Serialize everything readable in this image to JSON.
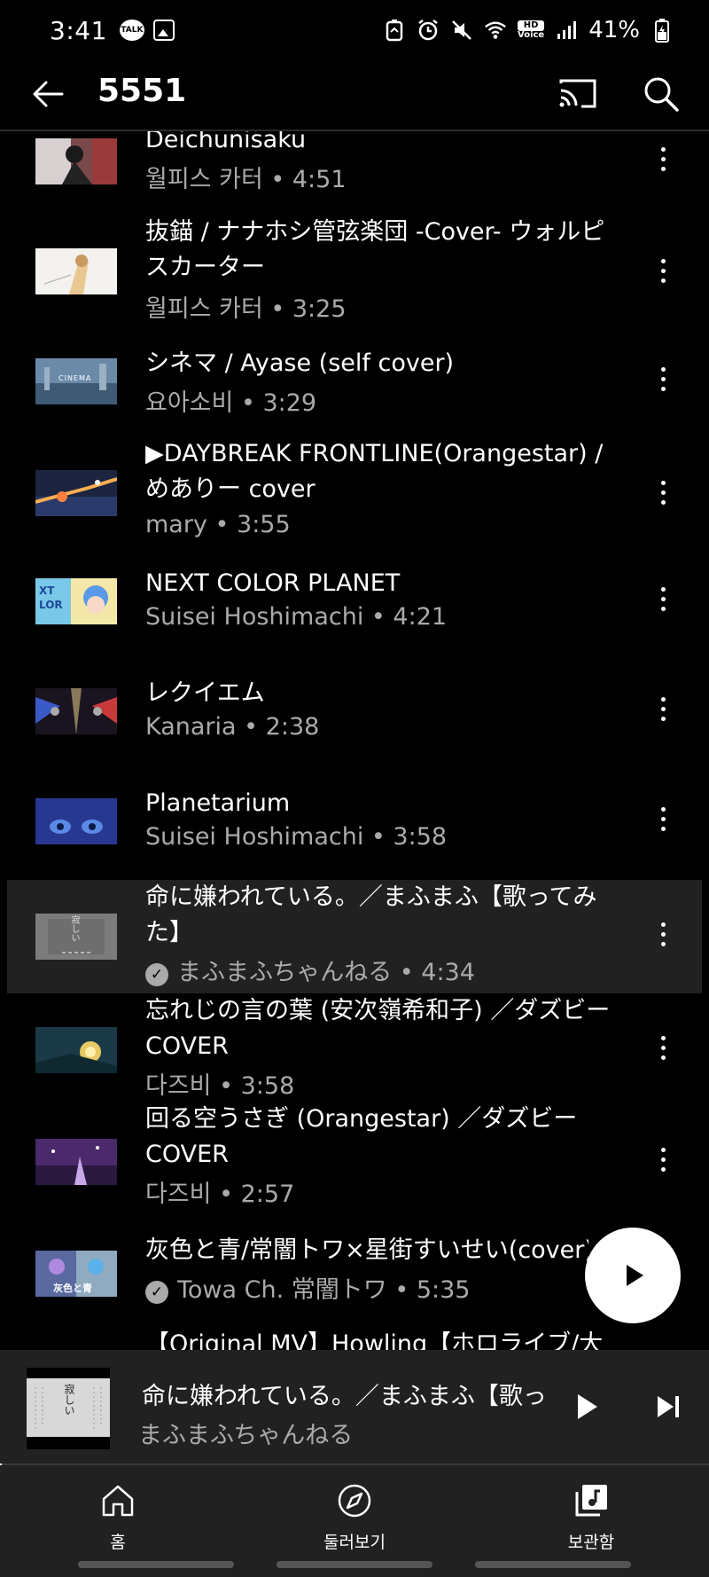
{
  "status_bar": {
    "time": "3:41",
    "talk_badge": "TALK",
    "hd_label_top": "HD",
    "hd_label_bottom": "Voice",
    "battery": "41%"
  },
  "app_bar": {
    "title": "5551"
  },
  "items": [
    {
      "title": "Deichunisaku",
      "subtitle": "월피스 카터 • 4:51",
      "thumb_color": "#8a5a5a"
    },
    {
      "title": "抜錨 / ナナホシ管弦楽団 -Cover- ウォルピスカーター",
      "subtitle": "월피스 카터 • 3:25",
      "thumb_color": "#f2efe8"
    },
    {
      "title": "シネマ / Ayase (self cover)",
      "subtitle": "요아소비 • 3:29",
      "thumb_color": "#5f7a92",
      "thumb_text": "CINEMA"
    },
    {
      "title": "▶DAYBREAK FRONTLINE(Orangestar) / めありー cover",
      "subtitle": "mary • 3:55",
      "thumb_color": "#3a4a7a"
    },
    {
      "title": "NEXT COLOR PLANET",
      "subtitle": "Suisei Hoshimachi • 4:21",
      "thumb_color": "#7ac0e8"
    },
    {
      "title": "レクイエム",
      "subtitle": "Kanaria • 2:38",
      "thumb_color": "#2a2030"
    },
    {
      "title": "Planetarium",
      "subtitle": "Suisei Hoshimachi • 3:58",
      "thumb_color": "#2a3c8a"
    },
    {
      "title": "命に嫌われている。／まふまふ【歌ってみた】",
      "subtitle": "まふまふちゃんねる • 4:34",
      "thumb_color": "#8a8a8a",
      "verified": true,
      "active": true,
      "thumb_text": "寂しい"
    },
    {
      "title": "忘れじの言の葉 (安次嶺希和子) ／ダズビー COVER",
      "subtitle": "다즈비 • 3:58",
      "thumb_color": "#2a5060"
    },
    {
      "title": "回る空うさぎ (Orangestar) ／ダズビー COVER",
      "subtitle": "다즈비 • 2:57",
      "thumb_color": "#6a4a8a"
    },
    {
      "title": "灰色と青/常闇トワ×星街すいせい(cover)",
      "subtitle": "Towa Ch. 常闇トワ • 5:35",
      "thumb_color": "#6a8aa0",
      "verified": true,
      "thumb_text": "灰色と青"
    },
    {
      "title": "【Original MV】Howling【ホロライブ/大",
      "subtitle": "",
      "thumb_color": "#000000"
    }
  ],
  "mini_player": {
    "title": "命に嫌われている。／まふまふ【歌ってみた】",
    "channel": "まふまふちゃんねる",
    "thumb_text": "寂しい",
    "progress": 0.002
  },
  "bottom_nav": [
    {
      "label": "홈",
      "icon": "home-icon"
    },
    {
      "label": "둘러보기",
      "icon": "compass-icon"
    },
    {
      "label": "보관함",
      "icon": "library-icon"
    }
  ],
  "colors": {
    "background": "#000000",
    "surface": "#212121",
    "secondary_text": "#aaaaaa",
    "primary_text": "#ffffff"
  }
}
